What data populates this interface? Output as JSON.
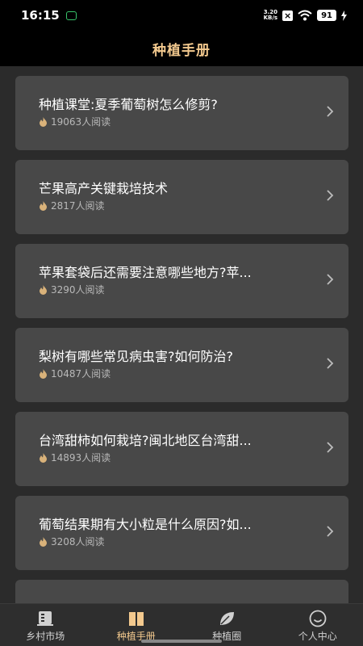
{
  "status": {
    "time": "16:15",
    "net_speed": "3.20",
    "net_unit": "KB/s",
    "sim_icon": "x-box",
    "battery": "91"
  },
  "header": {
    "title": "种植手册"
  },
  "articles": [
    {
      "title": "种植课堂:夏季葡萄树怎么修剪?",
      "reads": "19063人阅读"
    },
    {
      "title": "芒果高产关键栽培技术",
      "reads": "2817人阅读"
    },
    {
      "title": "苹果套袋后还需要注意哪些地方?苹...",
      "reads": "3290人阅读"
    },
    {
      "title": "梨树有哪些常见病虫害?如何防治?",
      "reads": "10487人阅读"
    },
    {
      "title": "台湾甜柿如何栽培?闽北地区台湾甜...",
      "reads": "14893人阅读"
    },
    {
      "title": "葡萄结果期有大小粒是什么原因?如...",
      "reads": "3208人阅读"
    },
    {
      "title": "",
      "reads": ""
    }
  ],
  "tabs": [
    {
      "label": "乡村市场",
      "icon": "market-icon",
      "active": false
    },
    {
      "label": "种植手册",
      "icon": "book-icon",
      "active": true
    },
    {
      "label": "种植圈",
      "icon": "leaf-icon",
      "active": false
    },
    {
      "label": "个人中心",
      "icon": "profile-icon",
      "active": false
    }
  ],
  "colors": {
    "accent": "#f3c98e",
    "card": "#484848",
    "background": "#2b2b2b"
  }
}
